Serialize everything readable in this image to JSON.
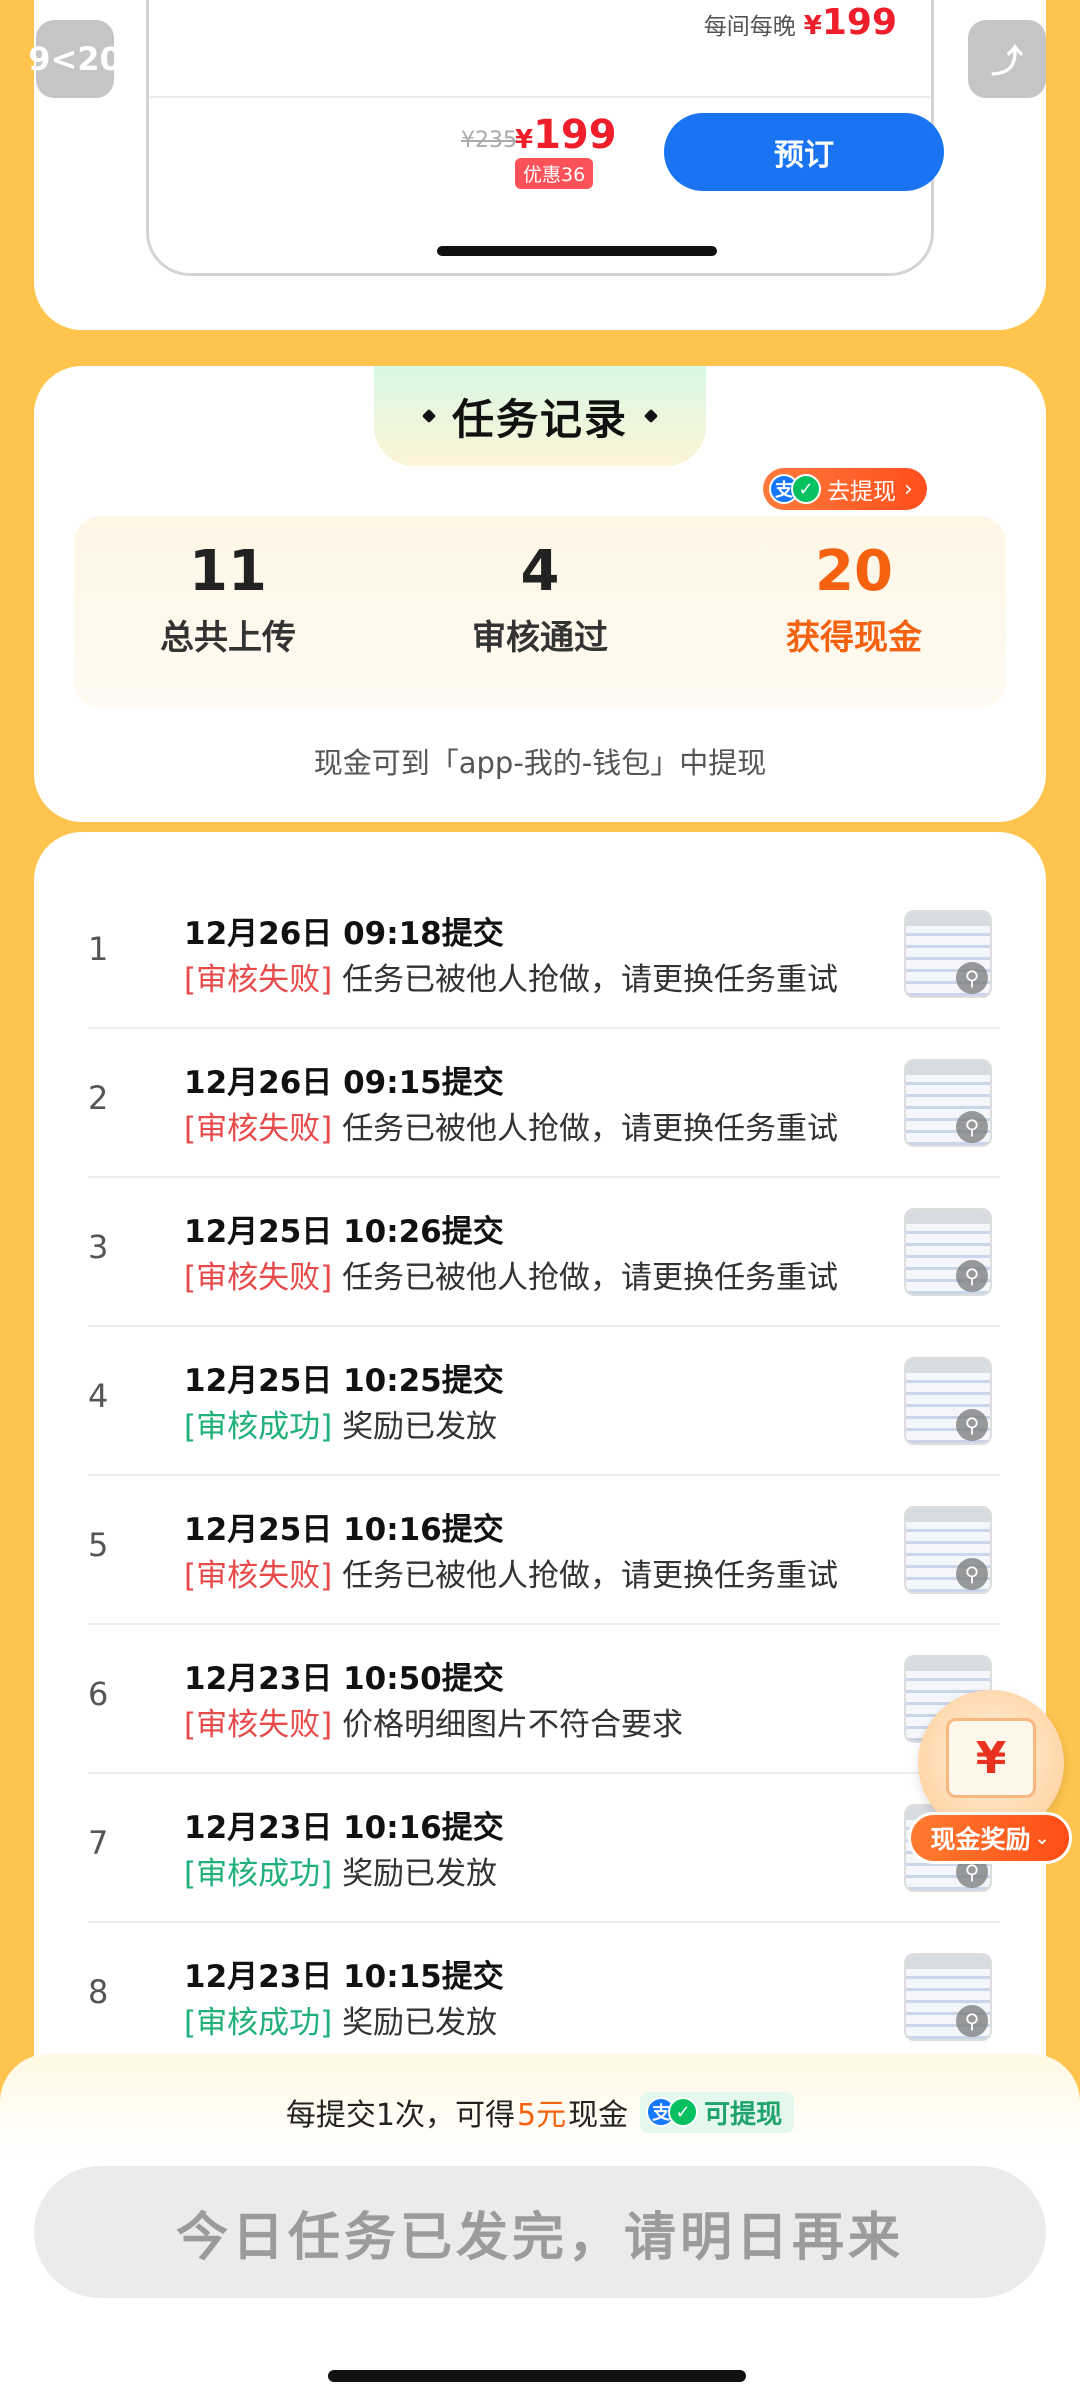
{
  "hotel_preview": {
    "per_night_label": "每间每晚",
    "per_night_currency": "¥",
    "per_night_amount": "199",
    "original_price": "¥235",
    "sale_currency": "¥",
    "sale_amount": "199",
    "discount_badge": "优惠36",
    "book_button": "预订",
    "left_float_text": "9<20",
    "right_float_text": "⤴"
  },
  "record": {
    "title": "任务记录",
    "withdraw_pill": "去提现",
    "pay_icons": [
      "alipay-icon",
      "wechat-icon"
    ],
    "stats": [
      {
        "value": "11",
        "label": "总共上传"
      },
      {
        "value": "4",
        "label": "审核通过"
      },
      {
        "value": "20",
        "label": "获得现金"
      }
    ],
    "cash_note": "现金可到「app-我的-钱包」中提现"
  },
  "tasks": [
    {
      "index": "1",
      "time": "12月26日 09:18提交",
      "tag": "[审核失败]",
      "tag_type": "fail",
      "message": "任务已被他人抢做，请更换任务重试"
    },
    {
      "index": "2",
      "time": "12月26日 09:15提交",
      "tag": "[审核失败]",
      "tag_type": "fail",
      "message": "任务已被他人抢做，请更换任务重试"
    },
    {
      "index": "3",
      "time": "12月25日 10:26提交",
      "tag": "[审核失败]",
      "tag_type": "fail",
      "message": "任务已被他人抢做，请更换任务重试"
    },
    {
      "index": "4",
      "time": "12月25日 10:25提交",
      "tag": "[审核成功]",
      "tag_type": "ok",
      "message": "奖励已发放"
    },
    {
      "index": "5",
      "time": "12月25日 10:16提交",
      "tag": "[审核失败]",
      "tag_type": "fail",
      "message": "任务已被他人抢做，请更换任务重试"
    },
    {
      "index": "6",
      "time": "12月23日 10:50提交",
      "tag": "[审核失败]",
      "tag_type": "fail",
      "message": "价格明细图片不符合要求"
    },
    {
      "index": "7",
      "time": "12月23日 10:16提交",
      "tag": "[审核成功]",
      "tag_type": "ok",
      "message": "奖励已发放"
    },
    {
      "index": "8",
      "time": "12月23日 10:15提交",
      "tag": "[审核成功]",
      "tag_type": "ok",
      "message": "奖励已发放"
    }
  ],
  "cash_reward": {
    "symbol": "¥",
    "label": "现金奖励"
  },
  "bottom": {
    "reward_prefix": "每提交1次，可得",
    "reward_amount": "5元",
    "reward_suffix": "现金",
    "withdraw_chip": "可提现",
    "done_button": "今日任务已发完，请明日再来"
  },
  "colors": {
    "background": "#FFC44E",
    "accent_orange": "#f5620f",
    "fail_red": "#e84a4a",
    "success_green": "#20b07a",
    "primary_blue": "#1a74f2",
    "price_red": "#ee1f2a"
  }
}
